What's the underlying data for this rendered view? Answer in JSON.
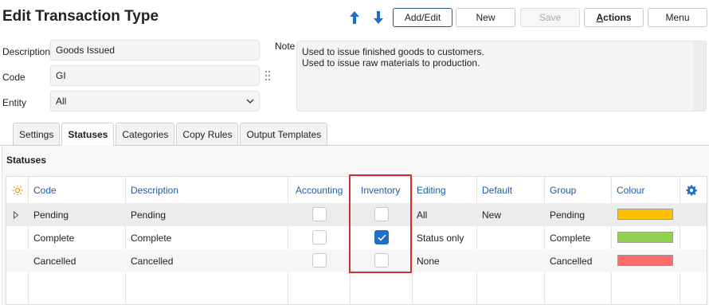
{
  "header": {
    "title": "Edit Transaction Type",
    "buttons": {
      "add_edit": "Add/Edit",
      "new": "New",
      "save": "Save",
      "actions_first": "A",
      "actions_rest": "ctions",
      "menu": "Menu"
    },
    "icons": [
      "arrow-up-icon",
      "arrow-down-icon"
    ],
    "accent_color": "#1f6fc4"
  },
  "form": {
    "description": {
      "label": "Description",
      "value": "Goods Issued"
    },
    "code": {
      "label": "Code",
      "value": "GI"
    },
    "entity": {
      "label": "Entity",
      "value": "All"
    },
    "note": {
      "label": "Note",
      "line1": "Used to issue finished goods to customers.",
      "line2": "Used to issue raw materials to production."
    }
  },
  "tabs": [
    "Settings",
    "Statuses",
    "Categories",
    "Copy Rules",
    "Output Templates"
  ],
  "active_tab": "Statuses",
  "statuses": {
    "title": "Statuses",
    "columns": [
      "Code",
      "Description",
      "Accounting",
      "Inventory",
      "Editing",
      "Default",
      "Group",
      "Colour"
    ],
    "rows": [
      {
        "code": "Pending",
        "description": "Pending",
        "accounting": false,
        "inventory": false,
        "editing": "All",
        "default": "New",
        "group": "Pending",
        "colour": "#ffc000"
      },
      {
        "code": "Complete",
        "description": "Complete",
        "accounting": false,
        "inventory": true,
        "editing": "Status only",
        "default": "",
        "group": "Complete",
        "colour": "#92d050"
      },
      {
        "code": "Cancelled",
        "description": "Cancelled",
        "accounting": false,
        "inventory": false,
        "editing": "None",
        "default": "",
        "group": "Cancelled",
        "colour": "#ff6b6b"
      }
    ]
  }
}
